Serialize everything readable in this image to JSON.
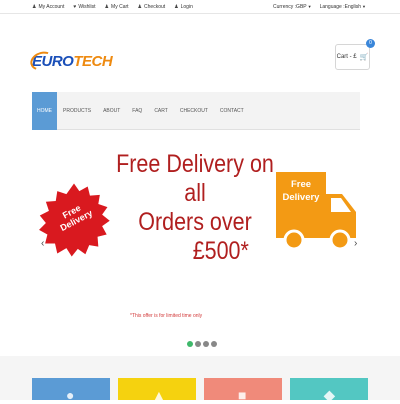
{
  "topbar": {
    "links": [
      {
        "label": "My Account",
        "icon": "user-icon"
      },
      {
        "label": "Wishlist",
        "icon": "heart-icon"
      },
      {
        "label": "My Cart",
        "icon": "user-icon"
      },
      {
        "label": "Checkout",
        "icon": "user-icon"
      },
      {
        "label": "Login",
        "icon": "user-icon"
      }
    ],
    "currency_label": "Currency :GBP",
    "language_label": "Language :English"
  },
  "logo": {
    "part1": "EURO",
    "part2": "TECH"
  },
  "cart": {
    "label": "Cart - £",
    "count": "0",
    "icon": "shopping-cart-icon"
  },
  "nav": {
    "items": [
      "HOME",
      "PRODUCTS",
      "ABOUT",
      "FAQ",
      "CART",
      "CHECKOUT",
      "CONTACT"
    ],
    "active_color": "#5b9bd5"
  },
  "slide": {
    "badge_line1": "Free",
    "badge_line2": "Delivery",
    "headline_line1": "Free Delivery on all",
    "headline_line2": "Orders over",
    "headline_amount": "£500*",
    "truck_line1": "Free",
    "truck_line2": "Delivery",
    "offer_note": "*This offer is for limited time only",
    "arrow_left": "‹",
    "arrow_right": "›",
    "headline_color": "#b01f1f",
    "badge_color": "#d9191f",
    "truck_color": "#f39a14"
  },
  "tiles": [
    {
      "color": "#5b9bd5",
      "icon": "tag-icon"
    },
    {
      "color": "#f5d20f",
      "icon": "number-icon"
    },
    {
      "color": "#f08a7a",
      "icon": "tag-icon"
    },
    {
      "color": "#53c7c2",
      "icon": "tag-icon"
    }
  ]
}
